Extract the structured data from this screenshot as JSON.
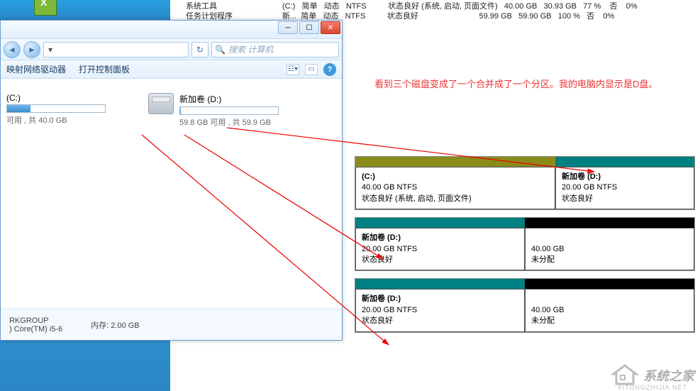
{
  "topTable": {
    "row1": "(C:)   简单   动态   NTFS          状态良好 (系统, 启动, 页面文件)   40.00 GB   30.93 GB   77 %    否    0%",
    "row2": "新...  简单   动态   NTFS          状态良好                            59.99 GB   59.90 GB   100 %   否    0%",
    "treeItem1": "系统工具",
    "treeItem2": "任务计划程序"
  },
  "explorer": {
    "searchPlaceholder": "搜索 计算机",
    "menu": {
      "m1": "映射网络驱动器",
      "m2": "打开控制面板"
    },
    "driveC": {
      "label": "(C:)",
      "sub": "可用 , 共 40.0 GB",
      "fillPct": 24
    },
    "driveD": {
      "label": "新加卷 (D:)",
      "sub": "59.8 GB 可用 , 共 59.9 GB",
      "fillPct": 1
    },
    "status": {
      "group": "RKGROUP",
      "mem": "内存: 2.00 GB",
      "cpu": ") Core(TM) i5-6"
    }
  },
  "annotation": "看到三个磁盘变成了一个合并成了一个分区。我的电脑内显示是D盘。",
  "dm": {
    "disk1": {
      "p1": {
        "name": "(C:)",
        "size": "40.00 GB NTFS",
        "state": "状态良好 (系统, 启动, 页面文件)"
      },
      "p2": {
        "name": "新加卷  (D:)",
        "size": "20.00 GB NTFS",
        "state": "状态良好"
      }
    },
    "disk2": {
      "p1": {
        "name": "新加卷  (D:)",
        "size": "20.00 GB NTFS",
        "state": "状态良好"
      },
      "p2": {
        "name": "",
        "size": "40.00 GB",
        "state": "未分配"
      }
    },
    "disk3": {
      "p1": {
        "name": "新加卷  (D:)",
        "size": "20.00 GB NTFS",
        "state": "状态良好"
      },
      "p2": {
        "name": "",
        "size": "40.00 GB",
        "state": "未分配"
      }
    }
  },
  "watermark": {
    "text": "系统之家",
    "url": "XITONGZHIJIA.NET"
  }
}
